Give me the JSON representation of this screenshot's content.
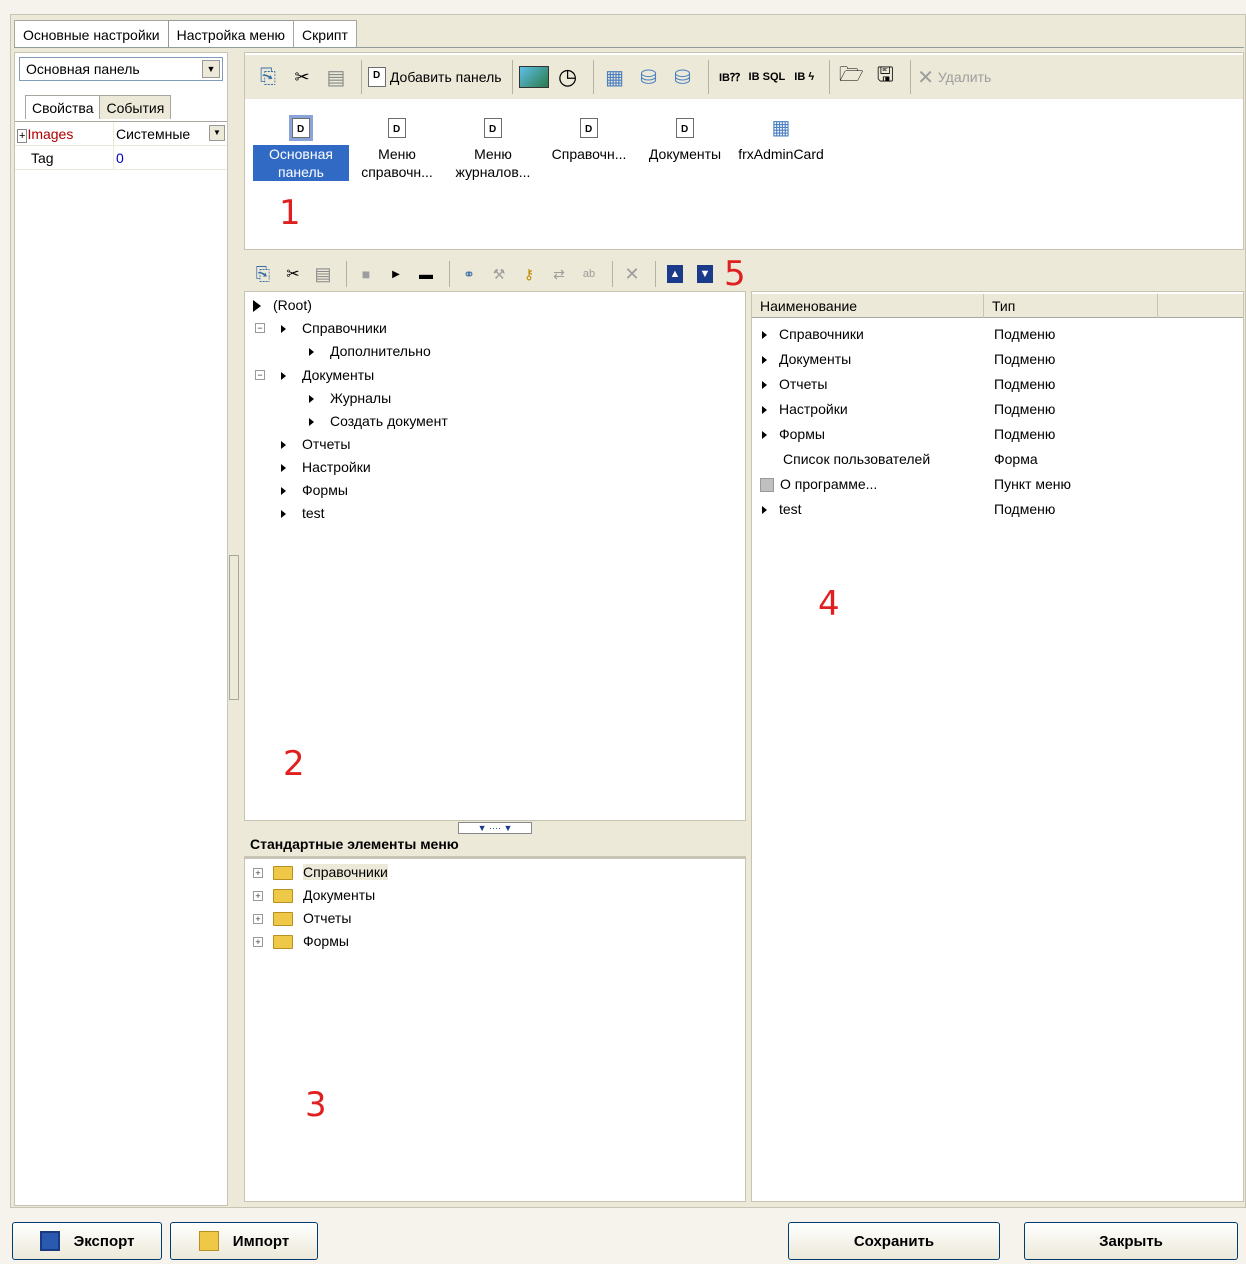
{
  "tabs": [
    "Основные настройки",
    "Настройка меню",
    "Скрипт"
  ],
  "left": {
    "combo_value": "Основная панель",
    "subtabs": [
      "Свойства",
      "События"
    ],
    "props": [
      {
        "key": "Images",
        "value": "Системные"
      },
      {
        "key": "Tag",
        "value": "0"
      }
    ]
  },
  "toolbar1": {
    "add_panel": "Добавить панель",
    "delete": "Удалить"
  },
  "panels": [
    "Основная панель",
    "Меню справочн...",
    "Меню журналов...",
    "Справочн...",
    "Документы",
    "frxAdminCard"
  ],
  "markers": [
    "1",
    "2",
    "3",
    "4",
    "5"
  ],
  "tree": {
    "root": "(Root)",
    "n1": "Справочники",
    "n1a": "Дополнительно",
    "n2": "Документы",
    "n2a": "Журналы",
    "n2b": "Создать документ",
    "n3": "Отчеты",
    "n4": "Настройки",
    "n5": "Формы",
    "n6": "test"
  },
  "std": {
    "title": "Стандартные элементы меню",
    "items": [
      "Справочники",
      "Документы",
      "Отчеты",
      "Формы"
    ]
  },
  "grid": {
    "headers": [
      "Наименование",
      "Тип"
    ],
    "rows": [
      {
        "name": "Справочники",
        "type": "Подменю"
      },
      {
        "name": "Документы",
        "type": "Подменю"
      },
      {
        "name": "Отчеты",
        "type": "Подменю"
      },
      {
        "name": "Настройки",
        "type": "Подменю"
      },
      {
        "name": "Формы",
        "type": "Подменю"
      },
      {
        "name": "Список пользователей",
        "type": "Форма"
      },
      {
        "name": "О программе...",
        "type": "Пункт меню"
      },
      {
        "name": "test",
        "type": "Подменю"
      }
    ]
  },
  "buttons": {
    "export": "Экспорт",
    "import": "Импорт",
    "save": "Сохранить",
    "close": "Закрыть"
  }
}
